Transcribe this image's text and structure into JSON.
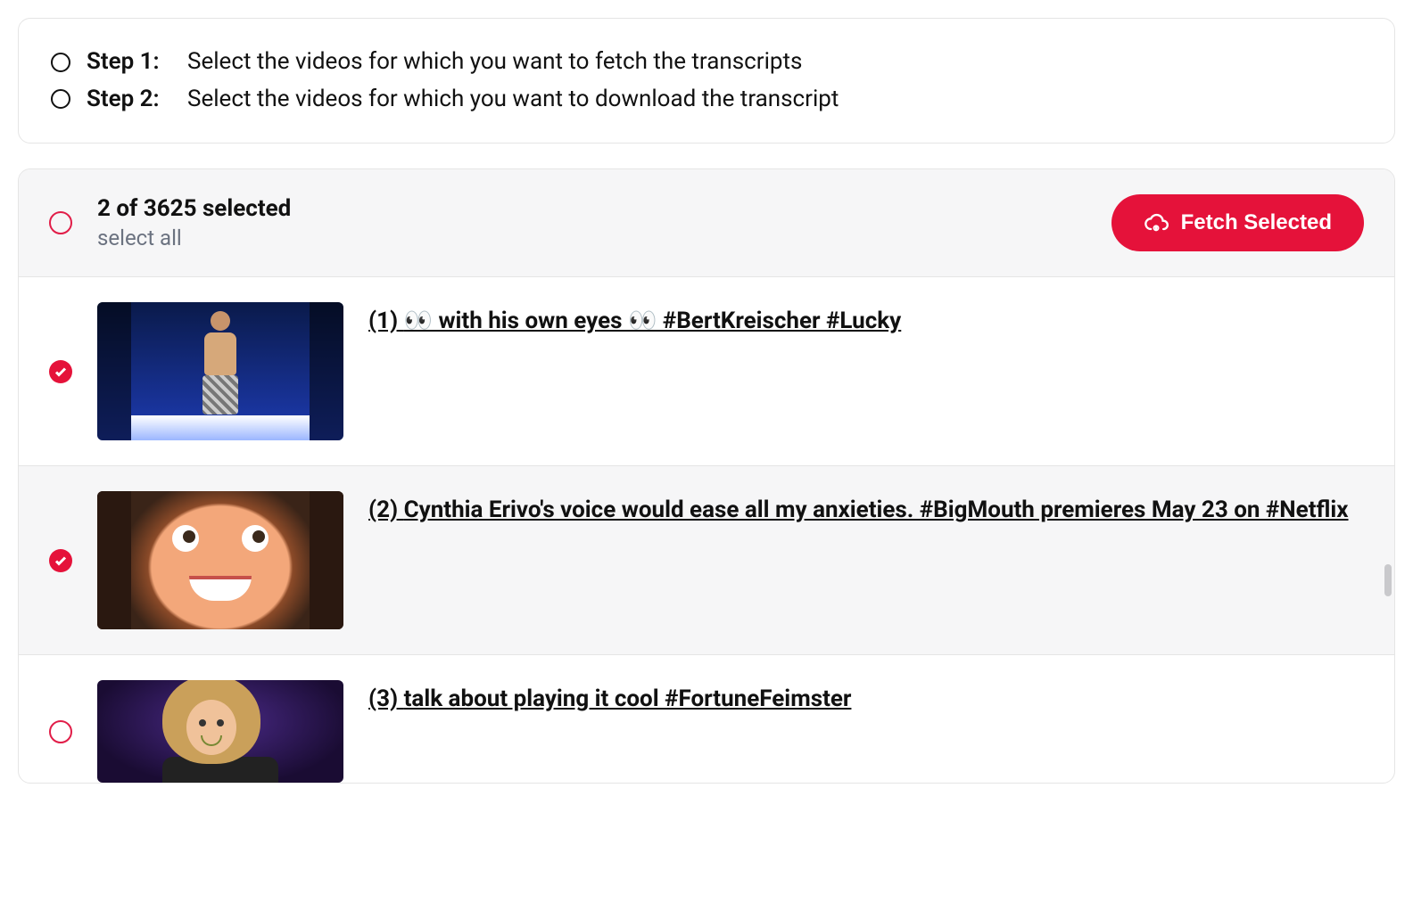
{
  "steps": [
    {
      "label": "Step 1:",
      "desc": "Select the videos for which you want to fetch the transcripts"
    },
    {
      "label": "Step 2:",
      "desc": "Select the videos for which you want to download the transcript"
    }
  ],
  "selection": {
    "count_text": "2 of 3625 selected",
    "select_all_label": "select all"
  },
  "fetch_button_label": "Fetch Selected",
  "videos": [
    {
      "index_prefix": "(1) ",
      "title": "👀 with his own eyes 👀 #BertKreischer #Lucky",
      "checked": true
    },
    {
      "index_prefix": "(2) ",
      "title": "Cynthia Erivo's voice would ease all my anxieties. #BigMouth premieres May 23 on #Netflix",
      "checked": true
    },
    {
      "index_prefix": "(3) ",
      "title": "talk about playing it cool #FortuneFeimster",
      "checked": false
    }
  ]
}
